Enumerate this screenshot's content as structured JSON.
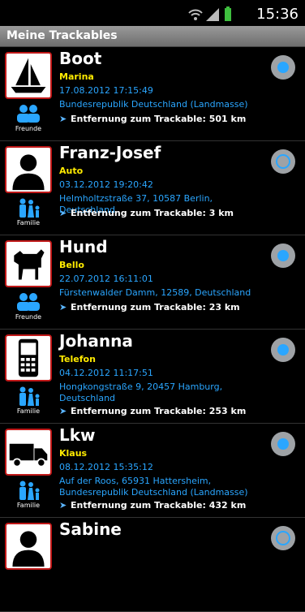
{
  "status_bar": {
    "time": "15:36"
  },
  "header": {
    "title": "Meine Trackables"
  },
  "items": [
    {
      "name": "Boot",
      "subtitle": "Marina",
      "datetime": "17.08.2012 17:15:49",
      "address": "Bundesrepublik Deutschland (Landmasse)",
      "distance": "Entfernung zum Trackable: 501 km",
      "category": "Freunde",
      "image": "boat-icon",
      "selected": true
    },
    {
      "name": "Franz-Josef",
      "subtitle": "Auto",
      "datetime": "03.12.2012 19:20:42",
      "address": "Helmholtzstraße 37, 10587 Berlin, Deutschland",
      "distance": "Entfernung zum Trackable: 3 km",
      "category": "Familie",
      "image": "person-icon",
      "selected": false
    },
    {
      "name": "Hund",
      "subtitle": "Bello",
      "datetime": "22.07.2012 16:11:01",
      "address": "Fürstenwalder Damm, 12589, Deutschland",
      "distance": "Entfernung zum Trackable: 23 km",
      "category": "Freunde",
      "image": "dog-icon",
      "selected": true
    },
    {
      "name": "Johanna",
      "subtitle": "Telefon",
      "datetime": "04.12.2012 11:17:51",
      "address": "Hongkongstraße 9, 20457 Hamburg, Deutschland",
      "distance": "Entfernung zum Trackable: 253 km",
      "category": "Familie",
      "image": "phone-icon",
      "selected": true
    },
    {
      "name": "Lkw",
      "subtitle": "Klaus",
      "datetime": "08.12.2012 15:35:12",
      "address": "Auf der Roos, 65931 Hattersheim, Bundesrepublik Deutschland (Landmasse)",
      "distance": "Entfernung zum Trackable: 432 km",
      "category": "Familie",
      "image": "truck-icon",
      "selected": true
    },
    {
      "name": "Sabine",
      "subtitle": "",
      "datetime": "",
      "address": "",
      "distance": "",
      "category": "",
      "image": "person-icon",
      "selected": false
    }
  ],
  "colors": {
    "accent": "#2aa6ff",
    "subtitle": "#ffeb00",
    "thumb_border": "#c01818"
  }
}
